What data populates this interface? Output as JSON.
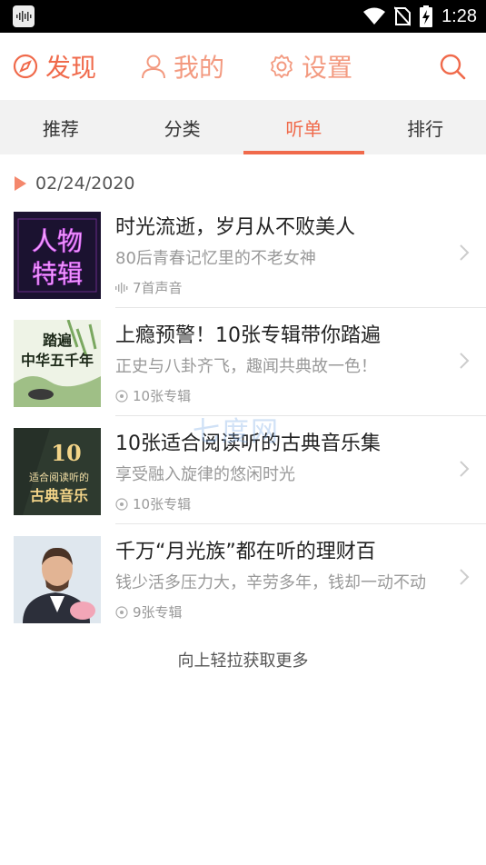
{
  "status_bar": {
    "time": "1:28"
  },
  "topnav": {
    "discover": "发现",
    "mine": "我的",
    "settings": "设置"
  },
  "tabs": [
    {
      "label": "推荐",
      "active": false
    },
    {
      "label": "分类",
      "active": false
    },
    {
      "label": "听单",
      "active": true
    },
    {
      "label": "排行",
      "active": false
    }
  ],
  "date": "02/24/2020",
  "items": [
    {
      "title": "时光流逝，岁月从不败美人",
      "subtitle": "80后青春记忆里的不老女神",
      "meta": "7首声音",
      "meta_icon": "sound-wave-icon",
      "thumb_text": [
        "人物",
        "特辑"
      ]
    },
    {
      "title": "上瘾预警！10张专辑带你踏遍",
      "subtitle": "正史与八卦齐飞，趣闻共典故一色！",
      "meta": "10张专辑",
      "meta_icon": "album-icon",
      "thumb_text": [
        "踏遍",
        "中华五千年"
      ]
    },
    {
      "title": "10张适合阅读听的古典音乐集",
      "subtitle": "享受融入旋律的悠闲时光",
      "meta": "10张专辑",
      "meta_icon": "album-icon",
      "thumb_text": [
        "10",
        "适合阅读听的",
        "古典音乐"
      ]
    },
    {
      "title": "千万“月光族”都在听的理财百",
      "subtitle": "钱少活多压力大，辛劳多年，钱却一动不动",
      "meta": "9张专辑",
      "meta_icon": "album-icon",
      "thumb_text": []
    }
  ],
  "load_more": "向上轻拉获取更多",
  "watermark": "七度网",
  "colors": {
    "accent": "#f06a4b",
    "accent_light": "#f39a80",
    "tab_bg": "#f2f2f2"
  }
}
